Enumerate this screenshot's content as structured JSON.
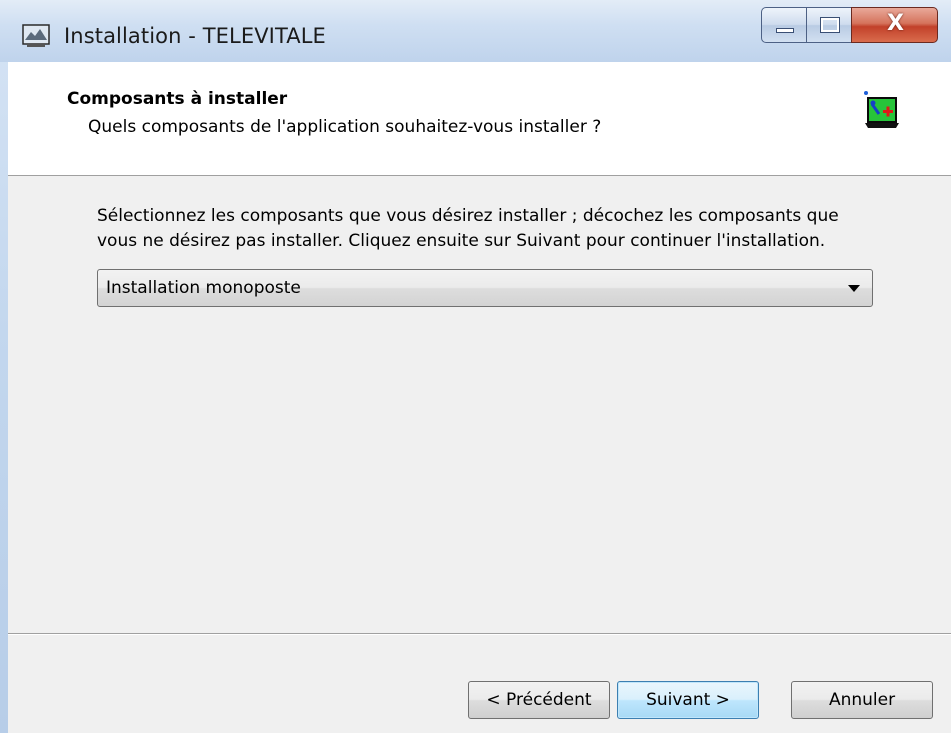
{
  "window": {
    "title": "Installation - TELEVITALE",
    "icon": "setup-app-icon",
    "caption": {
      "minimize_icon": "minimize-icon",
      "maximize_icon": "maximize-icon",
      "close_glyph": "X"
    }
  },
  "header": {
    "title": "Composants à installer",
    "subtitle": "Quels composants de l'application souhaitez-vous installer ?",
    "icon": "components-install-icon"
  },
  "body": {
    "instructions": "Sélectionnez les composants que vous désirez installer ; décochez les composants que\nvous ne désirez pas installer. Cliquez ensuite sur Suivant pour continuer l'installation.",
    "setup_type": {
      "selected": "Installation monoposte"
    }
  },
  "footer": {
    "back_label": "< Précédent",
    "next_label": "Suivant >",
    "cancel_label": "Annuler"
  }
}
